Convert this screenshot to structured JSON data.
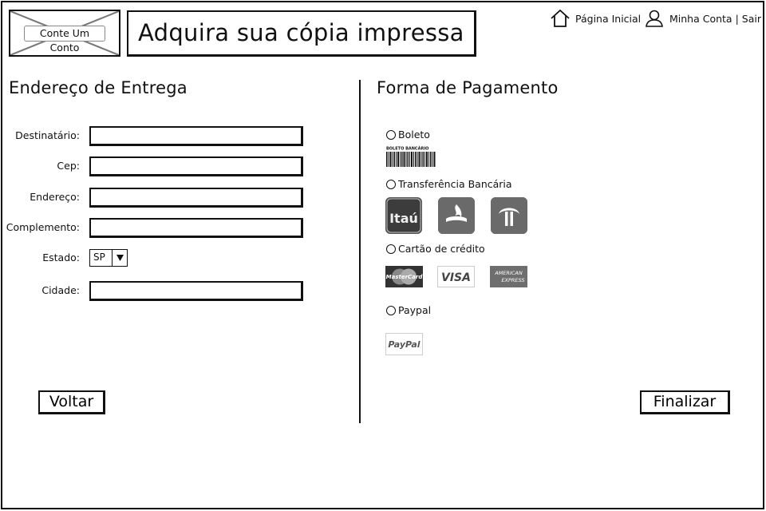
{
  "header": {
    "logo_label": "Conte Um Conto",
    "title": "Adquira sua cópia impressa"
  },
  "nav": {
    "home_label": "Página Inicial",
    "account_label": "Minha Conta | Sair"
  },
  "shipping": {
    "title": "Endereço de Entrega",
    "fields": [
      {
        "label": "Destinatário:",
        "value": ""
      },
      {
        "label": "Cep:",
        "value": ""
      },
      {
        "label": "Endereço:",
        "value": ""
      },
      {
        "label": "Complemento:",
        "value": ""
      }
    ],
    "state": {
      "label": "Estado:",
      "value": "SP"
    },
    "city": {
      "label": "Cidade:",
      "value": ""
    }
  },
  "payment": {
    "title": "Forma de Pagamento",
    "options": [
      {
        "label": "Boleto",
        "selected": false
      },
      {
        "label": "Transferência Bancária",
        "selected": false
      },
      {
        "label": "Cartão de crédito",
        "selected": false
      },
      {
        "label": "Paypal",
        "selected": false
      }
    ],
    "boleto_caption": "BOLETO BANCÁRIO",
    "banks": [
      {
        "name": "Itaú",
        "icon": "itau-logo-icon"
      },
      {
        "name": "Santander",
        "icon": "santander-logo-icon"
      },
      {
        "name": "Bradesco",
        "icon": "bradesco-logo-icon"
      }
    ],
    "cards": [
      {
        "name": "MasterCard",
        "icon": "mastercard-logo-icon"
      },
      {
        "name": "VISA",
        "icon": "visa-logo-icon"
      },
      {
        "name": "AMERICAN EXPRESS",
        "line1": "AMERICAN",
        "line2": "EXPRESS",
        "icon": "amex-logo-icon"
      }
    ],
    "paypal": {
      "name": "PayPal",
      "icon": "paypal-logo-icon"
    }
  },
  "actions": {
    "back_label": "Voltar",
    "finish_label": "Finalizar"
  }
}
